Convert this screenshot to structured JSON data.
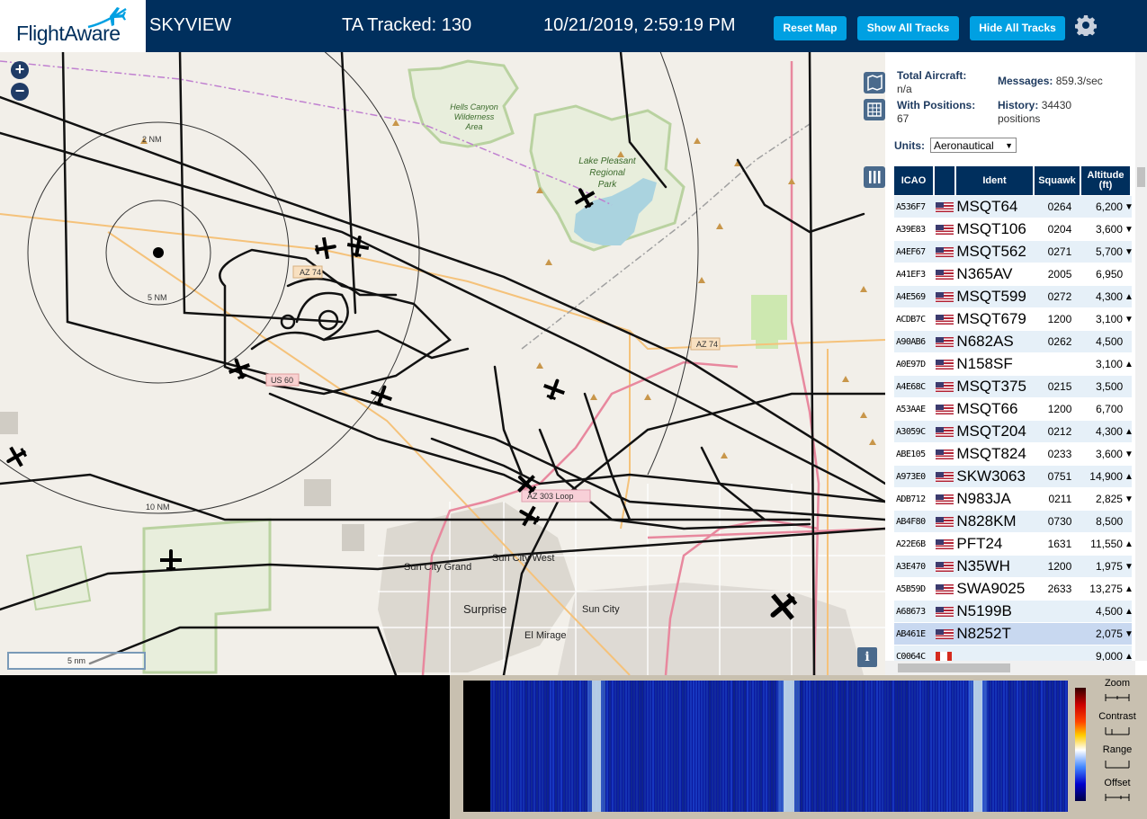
{
  "header": {
    "logo_text": "FlightAware",
    "app_name": "SKYVIEW",
    "tracked": "TA Tracked: 130",
    "datetime": "10/21/2019, 2:59:19 PM",
    "buttons": {
      "reset": "Reset Map",
      "show": "Show All Tracks",
      "hide": "Hide All Tracks"
    }
  },
  "map": {
    "labels": {
      "hells_canyon": [
        "Hells Canyon",
        "Wilderness",
        "Area"
      ],
      "lake_pleasant": [
        "Lake Pleasant",
        "Regional",
        "Park"
      ],
      "ring_2": "2 NM",
      "ring_5": "5 NM",
      "ring_10": "10 NM",
      "az74_a": "AZ 74",
      "az74_b": "AZ 74",
      "us60": "US 60",
      "az303": "AZ 303 Loop",
      "sun_city_grand": "Sun City Grand",
      "sun_city_west": "Sun City West",
      "surprise": "Surprise",
      "sun_city": "Sun City",
      "el_mirage": "El Mirage"
    },
    "scale": "5 nm",
    "info": "i"
  },
  "stats": {
    "total_aircraft_label": "Total Aircraft:",
    "total_aircraft": "n/a",
    "with_positions_label": "With Positions:",
    "with_positions": "67",
    "messages_label": "Messages:",
    "messages": "859.3/sec",
    "history_label": "History:",
    "history": "34430",
    "history_unit": "positions"
  },
  "units": {
    "label": "Units:",
    "value": "Aeronautical"
  },
  "table": {
    "headers": {
      "icao": "ICAO",
      "ident": "Ident",
      "squawk": "Squawk",
      "altitude": "Altitude (ft)"
    },
    "rows": [
      {
        "icao": "A536F7",
        "ident": "MSQT64",
        "squawk": "0264",
        "alt": "6,200",
        "trend": "▼",
        "flag": "us"
      },
      {
        "icao": "A39E83",
        "ident": "MSQT106",
        "squawk": "0204",
        "alt": "3,600",
        "trend": "▼",
        "flag": "us"
      },
      {
        "icao": "A4EF67",
        "ident": "MSQT562",
        "squawk": "0271",
        "alt": "5,700",
        "trend": "▼",
        "flag": "us"
      },
      {
        "icao": "A41EF3",
        "ident": "N365AV",
        "squawk": "2005",
        "alt": "6,950",
        "trend": "",
        "flag": "us"
      },
      {
        "icao": "A4E569",
        "ident": "MSQT599",
        "squawk": "0272",
        "alt": "4,300",
        "trend": "▲",
        "flag": "us"
      },
      {
        "icao": "ACDB7C",
        "ident": "MSQT679",
        "squawk": "1200",
        "alt": "3,100",
        "trend": "▼",
        "flag": "us"
      },
      {
        "icao": "A90AB6",
        "ident": "N682AS",
        "squawk": "0262",
        "alt": "4,500",
        "trend": "",
        "flag": "us"
      },
      {
        "icao": "A0E97D",
        "ident": "N158SF",
        "squawk": "",
        "alt": "3,100",
        "trend": "▲",
        "flag": "us"
      },
      {
        "icao": "A4E68C",
        "ident": "MSQT375",
        "squawk": "0215",
        "alt": "3,500",
        "trend": "",
        "flag": "us"
      },
      {
        "icao": "A53AAE",
        "ident": "MSQT66",
        "squawk": "1200",
        "alt": "6,700",
        "trend": "",
        "flag": "us"
      },
      {
        "icao": "A3059C",
        "ident": "MSQT204",
        "squawk": "0212",
        "alt": "4,300",
        "trend": "▲",
        "flag": "us"
      },
      {
        "icao": "ABE105",
        "ident": "MSQT824",
        "squawk": "0233",
        "alt": "3,600",
        "trend": "▼",
        "flag": "us"
      },
      {
        "icao": "A973E0",
        "ident": "SKW3063",
        "squawk": "0751",
        "alt": "14,900",
        "trend": "▲",
        "flag": "us"
      },
      {
        "icao": "ADB712",
        "ident": "N983JA",
        "squawk": "0211",
        "alt": "2,825",
        "trend": "▼",
        "flag": "us"
      },
      {
        "icao": "AB4F80",
        "ident": "N828KM",
        "squawk": "0730",
        "alt": "8,500",
        "trend": "",
        "flag": "us"
      },
      {
        "icao": "A22E6B",
        "ident": "PFT24",
        "squawk": "1631",
        "alt": "11,550",
        "trend": "▲",
        "flag": "us"
      },
      {
        "icao": "A3E470",
        "ident": "N35WH",
        "squawk": "1200",
        "alt": "1,975",
        "trend": "▼",
        "flag": "us"
      },
      {
        "icao": "A5B59D",
        "ident": "SWA9025",
        "squawk": "2633",
        "alt": "13,275",
        "trend": "▲",
        "flag": "us"
      },
      {
        "icao": "A68673",
        "ident": "N5199B",
        "squawk": "",
        "alt": "4,500",
        "trend": "▲",
        "flag": "us"
      },
      {
        "icao": "AB461E",
        "ident": "N8252T",
        "squawk": "",
        "alt": "2,075",
        "trend": "▼",
        "flag": "us",
        "selected": true
      },
      {
        "icao": "C0064C",
        "ident": "",
        "squawk": "",
        "alt": "9,000",
        "trend": "▲",
        "flag": "ca"
      }
    ]
  },
  "waterfall": {
    "labels": {
      "zoom": "Zoom",
      "contrast": "Contrast",
      "range": "Range",
      "offset": "Offset"
    }
  },
  "colors": {
    "header_bg": "#002f5d",
    "button_bg": "#00a0e2",
    "table_header_bg": "#002f5d"
  },
  "icons": [
    "plane-logo-icon",
    "gear-icon",
    "zoom-in-icon",
    "zoom-out-icon",
    "map-layers-icon",
    "grid-icon",
    "columns-icon",
    "info-icon",
    "aircraft-icon",
    "us-flag-icon",
    "canada-flag-icon"
  ]
}
